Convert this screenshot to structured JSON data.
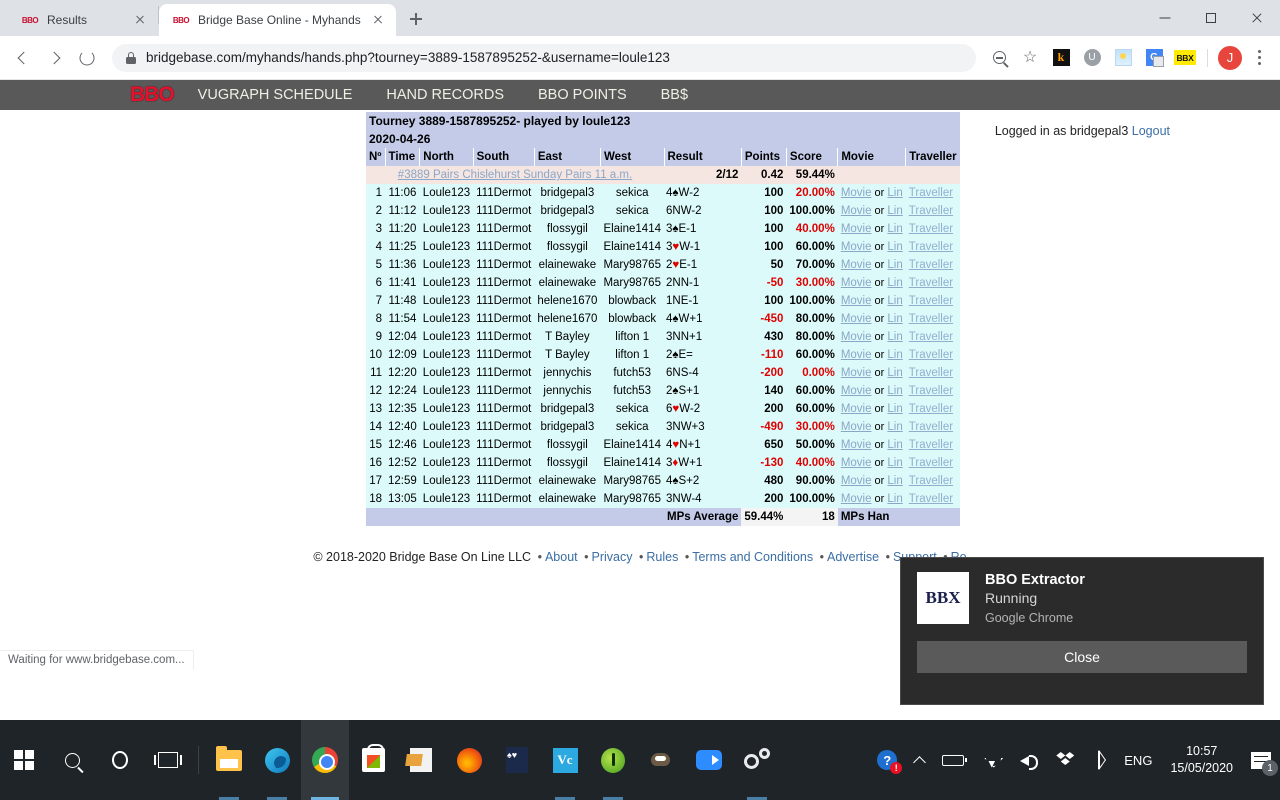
{
  "browser": {
    "tabs": [
      {
        "title": "Results",
        "favicon": "BBO",
        "active": false
      },
      {
        "title": "Bridge Base Online - Myhands",
        "favicon": "BBO",
        "active": true
      }
    ],
    "url": "bridgebase.com/myhands/hands.php?tourney=3889-1587895252-&username=loule123",
    "status_text": "Waiting for www.bridgebase.com...",
    "extensions": [
      {
        "name": "k-extension",
        "label": "k"
      },
      {
        "name": "u-extension",
        "label": "U"
      },
      {
        "name": "image-extension",
        "label": ""
      },
      {
        "name": "google-translate-extension",
        "label": "G"
      },
      {
        "name": "bbx-extension",
        "label": "BBX"
      }
    ],
    "profile_initial": "J"
  },
  "site": {
    "logo": "BBO",
    "nav": [
      "VUGRAPH SCHEDULE",
      "HAND RECORDS",
      "BBO POINTS",
      "BB$"
    ],
    "login_text": "Logged in as bridgepal3",
    "logout_label": "Logout",
    "footer": {
      "copyright": "© 2018-2020 Bridge Base On Line LLC",
      "links": [
        "About",
        "Privacy",
        "Rules",
        "Terms and Conditions",
        "Advertise",
        "Support",
        "Ro"
      ]
    }
  },
  "results": {
    "title": "Tourney 3889-1587895252- played by loule123",
    "date": "2020-04-26",
    "columns": [
      "Nº",
      "Time",
      "North",
      "South",
      "East",
      "West",
      "Result",
      "Points",
      "Score",
      "Movie",
      "Traveller"
    ],
    "tourney_row": {
      "name": "#3889 Pairs Chislehurst Sunday Pairs 11 a.m.",
      "result": "2/12",
      "points": "0.42",
      "score": "59.44%"
    },
    "movie_label": "Movie",
    "or_label": "or",
    "lin_label": "Lin",
    "traveller_label": "Traveller",
    "rows": [
      {
        "n": "1",
        "time": "11:06",
        "north": "Loule123",
        "south": "111Dermot",
        "east": "bridgepal3",
        "west": "sekica",
        "result": "4♠W-2",
        "suit": "s",
        "points": "100",
        "neg": false,
        "score": "20.00%",
        "low": true
      },
      {
        "n": "2",
        "time": "11:12",
        "north": "Loule123",
        "south": "111Dermot",
        "east": "bridgepal3",
        "west": "sekica",
        "result": "6NW-2",
        "suit": "",
        "points": "100",
        "neg": false,
        "score": "100.00%",
        "low": false
      },
      {
        "n": "3",
        "time": "11:20",
        "north": "Loule123",
        "south": "111Dermot",
        "east": "flossygil",
        "west": "Elaine1414",
        "result": "3♠E-1",
        "suit": "s",
        "points": "100",
        "neg": false,
        "score": "40.00%",
        "low": true
      },
      {
        "n": "4",
        "time": "11:25",
        "north": "Loule123",
        "south": "111Dermot",
        "east": "flossygil",
        "west": "Elaine1414",
        "result": "3♥W-1",
        "suit": "h",
        "points": "100",
        "neg": false,
        "score": "60.00%",
        "low": false
      },
      {
        "n": "5",
        "time": "11:36",
        "north": "Loule123",
        "south": "111Dermot",
        "east": "elainewake",
        "west": "Mary98765",
        "result": "2♥E-1",
        "suit": "h",
        "points": "50",
        "neg": false,
        "score": "70.00%",
        "low": false
      },
      {
        "n": "6",
        "time": "11:41",
        "north": "Loule123",
        "south": "111Dermot",
        "east": "elainewake",
        "west": "Mary98765",
        "result": "2NN-1",
        "suit": "",
        "points": "-50",
        "neg": true,
        "score": "30.00%",
        "low": true
      },
      {
        "n": "7",
        "time": "11:48",
        "north": "Loule123",
        "south": "111Dermot",
        "east": "helene1670",
        "west": "blowback",
        "result": "1NE-1",
        "suit": "",
        "points": "100",
        "neg": false,
        "score": "100.00%",
        "low": false
      },
      {
        "n": "8",
        "time": "11:54",
        "north": "Loule123",
        "south": "111Dermot",
        "east": "helene1670",
        "west": "blowback",
        "result": "4♠W+1",
        "suit": "s",
        "points": "-450",
        "neg": true,
        "score": "80.00%",
        "low": false
      },
      {
        "n": "9",
        "time": "12:04",
        "north": "Loule123",
        "south": "111Dermot",
        "east": "T Bayley",
        "west": "lifton 1",
        "result": "3NN+1",
        "suit": "",
        "points": "430",
        "neg": false,
        "score": "80.00%",
        "low": false
      },
      {
        "n": "10",
        "time": "12:09",
        "north": "Loule123",
        "south": "111Dermot",
        "east": "T Bayley",
        "west": "lifton 1",
        "result": "2♠E=",
        "suit": "s",
        "points": "-110",
        "neg": true,
        "score": "60.00%",
        "low": false
      },
      {
        "n": "11",
        "time": "12:20",
        "north": "Loule123",
        "south": "111Dermot",
        "east": "jennychis",
        "west": "futch53",
        "result": "6NS-4",
        "suit": "",
        "points": "-200",
        "neg": true,
        "score": "0.00%",
        "low": true
      },
      {
        "n": "12",
        "time": "12:24",
        "north": "Loule123",
        "south": "111Dermot",
        "east": "jennychis",
        "west": "futch53",
        "result": "2♠S+1",
        "suit": "s",
        "points": "140",
        "neg": false,
        "score": "60.00%",
        "low": false
      },
      {
        "n": "13",
        "time": "12:35",
        "north": "Loule123",
        "south": "111Dermot",
        "east": "bridgepal3",
        "west": "sekica",
        "result": "6♥W-2",
        "suit": "h",
        "points": "200",
        "neg": false,
        "score": "60.00%",
        "low": false
      },
      {
        "n": "14",
        "time": "12:40",
        "north": "Loule123",
        "south": "111Dermot",
        "east": "bridgepal3",
        "west": "sekica",
        "result": "3NW+3",
        "suit": "",
        "points": "-490",
        "neg": true,
        "score": "30.00%",
        "low": true
      },
      {
        "n": "15",
        "time": "12:46",
        "north": "Loule123",
        "south": "111Dermot",
        "east": "flossygil",
        "west": "Elaine1414",
        "result": "4♥N+1",
        "suit": "h",
        "points": "650",
        "neg": false,
        "score": "50.00%",
        "low": false
      },
      {
        "n": "16",
        "time": "12:52",
        "north": "Loule123",
        "south": "111Dermot",
        "east": "flossygil",
        "west": "Elaine1414",
        "result": "3♦W+1",
        "suit": "d",
        "points": "-130",
        "neg": true,
        "score": "40.00%",
        "low": true
      },
      {
        "n": "17",
        "time": "12:59",
        "north": "Loule123",
        "south": "111Dermot",
        "east": "elainewake",
        "west": "Mary98765",
        "result": "4♠S+2",
        "suit": "s",
        "points": "480",
        "neg": false,
        "score": "90.00%",
        "low": false
      },
      {
        "n": "18",
        "time": "13:05",
        "north": "Loule123",
        "south": "111Dermot",
        "east": "elainewake",
        "west": "Mary98765",
        "result": "3NW-4",
        "suit": "",
        "points": "200",
        "neg": false,
        "score": "100.00%",
        "low": false
      }
    ],
    "footer_row": {
      "mps_average_label": "MPs Average",
      "mps_average_value": "59.44%",
      "hands_count": "18",
      "hands_label": "MPs Han"
    }
  },
  "notification": {
    "logo": "BBX",
    "title": "BBO Extractor",
    "subtitle": "Running",
    "source": "Google Chrome",
    "close_label": "Close"
  },
  "taskbar": {
    "language": "ENG",
    "time": "10:57",
    "date": "15/05/2020",
    "notification_count": "1"
  }
}
